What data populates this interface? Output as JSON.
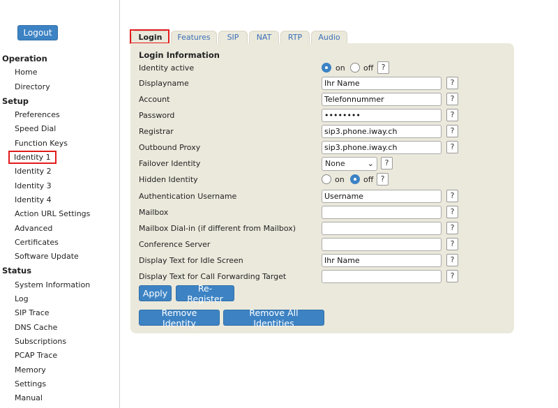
{
  "sidebar": {
    "logout_label": "Logout",
    "sections": [
      {
        "title": "Operation",
        "items": [
          "Home",
          "Directory"
        ]
      },
      {
        "title": "Setup",
        "items": [
          "Preferences",
          "Speed Dial",
          "Function Keys",
          "Identity 1",
          "Identity 2",
          "Identity 3",
          "Identity 4",
          "Action URL Settings",
          "Advanced",
          "Certificates",
          "Software Update"
        ]
      },
      {
        "title": "Status",
        "items": [
          "System Information",
          "Log",
          "SIP Trace",
          "DNS Cache",
          "Subscriptions",
          "PCAP Trace",
          "Memory",
          "Settings",
          "Manual"
        ]
      }
    ]
  },
  "tabs": [
    "Login",
    "Features",
    "SIP",
    "NAT",
    "RTP",
    "Audio"
  ],
  "panel": {
    "title": "Login Information",
    "help_label": "?",
    "on_label": "on",
    "off_label": "off",
    "rows": {
      "identity_active": {
        "label": "Identity active",
        "value": "on"
      },
      "displayname": {
        "label": "Displayname",
        "value": "Ihr Name"
      },
      "account": {
        "label": "Account",
        "value": "Telefonnummer"
      },
      "password": {
        "label": "Password",
        "value": "••••••••"
      },
      "registrar": {
        "label": "Registrar",
        "value": "sip3.phone.iway.ch"
      },
      "outbound_proxy": {
        "label": "Outbound Proxy",
        "value": "sip3.phone.iway.ch"
      },
      "failover_identity": {
        "label": "Failover Identity",
        "value": "None"
      },
      "hidden_identity": {
        "label": "Hidden Identity",
        "value": "off"
      },
      "auth_username": {
        "label": "Authentication Username",
        "value": "Username"
      },
      "mailbox": {
        "label": "Mailbox",
        "value": ""
      },
      "mailbox_dialin": {
        "label": "Mailbox Dial-in (if different from Mailbox)",
        "value": ""
      },
      "conference_server": {
        "label": "Conference Server",
        "value": ""
      },
      "idle_text": {
        "label": "Display Text for Idle Screen",
        "value": "Ihr Name"
      },
      "call_fwd_text": {
        "label": "Display Text for Call Forwarding Target",
        "value": ""
      }
    },
    "buttons": {
      "apply": "Apply",
      "reregister": "Re-Register",
      "remove_identity": "Remove Identity",
      "remove_all": "Remove All Identities"
    }
  },
  "colors": {
    "accent": "#3d83c4",
    "panel_bg": "#ebe9dc",
    "highlight": "#e21b1b",
    "tab_text": "#3b6eb5"
  }
}
